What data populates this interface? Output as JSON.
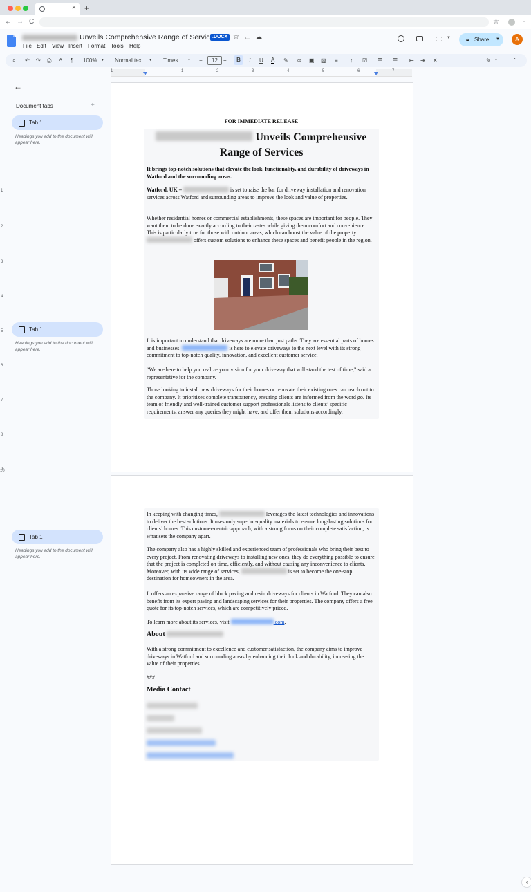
{
  "browser": {
    "new_tab": "+",
    "close_tab": "×",
    "nav_back": "←",
    "nav_forward": "→",
    "reload": "C"
  },
  "header": {
    "title": "Unveils Comprehensive Range of Services",
    "badge": ".DOCX",
    "menus": [
      "File",
      "Edit",
      "View",
      "Insert",
      "Format",
      "Tools",
      "Help"
    ],
    "share_label": "Share",
    "avatar_letter": "A"
  },
  "toolbar": {
    "zoom": "100%",
    "style": "Normal text",
    "font": "Times ...",
    "font_size": "12",
    "minus": "−",
    "plus": "+",
    "bold": "B",
    "italic": "I",
    "underline": "U",
    "text_color": "A"
  },
  "ruler": {
    "numbers": [
      "1",
      "1",
      "2",
      "3",
      "4",
      "5",
      "6",
      "7"
    ],
    "vertical": [
      "1",
      "2",
      "3",
      "4",
      "5",
      "6",
      "7",
      "8",
      "9",
      "10"
    ]
  },
  "sidebar": {
    "heading": "Document tabs",
    "add": "+",
    "tabs": [
      {
        "label": "Tab 1",
        "hint": "Headings you add to the document will appear here."
      },
      {
        "label": "Tab 1",
        "hint": "Headings you add to the document will appear here."
      },
      {
        "label": "Tab 1",
        "hint": "Headings you add to the document will appear here."
      }
    ]
  },
  "document": {
    "release": "FOR IMMEDIATE RELEASE",
    "headline": "Unveils Comprehensive Range of Services",
    "subhead": "It brings top-notch solutions that elevate the look, functionality, and durability of driveways in Watford and the surrounding areas.",
    "dateline": "Watford, UK –",
    "p1": "is set to raise the bar for driveway installation and renovation services across Watford and surrounding areas to improve the look and value of properties.",
    "p2a": "Whether residential homes or commercial establishments, these spaces are important for people. They want them to be done exactly according to their tastes while giving them comfort and convenience. This is particularly true for those with outdoor areas, which can boost the value of the property.",
    "p2b": "offers custom solutions to enhance these spaces and benefit people in the region.",
    "p3a": "It is important to understand that driveways are more than just paths. They are essential parts of homes and businesses.",
    "p3b": "is here to elevate driveways to the next level with its strong commitment to top-notch quality, innovation, and excellent customer service.",
    "p4": "“We are here to help you realize your vision for your driveway that will stand the test of time,” said a representative for the company.",
    "p5": "Those looking to install new driveways for their homes or renovate their existing ones can reach out to the company. It prioritizes complete transparency, ensuring clients are informed from the word go. Its team of friendly and well-trained customer support professionals listens to clients’ specific requirements, answer any queries they might have, and offer them solutions accordingly.",
    "p6a": "In keeping with changing times,",
    "p6b": "leverages the latest technologies and innovations to deliver the best solutions. It uses only superior-quality materials to ensure long-lasting solutions for clients’ homes. This customer-centric approach, with a strong focus on their complete satisfaction, is what sets the company apart.",
    "p7a": "The company also has a highly skilled and experienced team of professionals who bring their best to every project. From renovating driveways to installing new ones, they do everything possible to ensure that the project is completed on time, efficiently, and without causing any inconvenience to clients. Moreover, with its wide range of services,",
    "p7b": "is set to become the one-stop destination for homeowners in the area.",
    "p8": "It offers an expansive range of block paving and resin driveways for clients in Watford. They can also benefit from its expert paving and landscaping services for their properties. The company offers a free quote for its top-notch services, which are competitively priced.",
    "p9": "To learn more about its services, visit",
    "p9_link": ".com",
    "p9_end": ".",
    "about_heading": "About",
    "about_text": "With a strong commitment to excellence and customer satisfaction, the company aims to improve driveways in Watford and surrounding areas by enhancing their look and durability, increasing the value of their properties.",
    "end_mark": "###",
    "media_heading": "Media Contact"
  },
  "colors": {
    "accent": "#0b57d0",
    "share_bg": "#c2e7ff",
    "tab_bg": "#d3e3fd",
    "avatar": "#e8710a"
  }
}
